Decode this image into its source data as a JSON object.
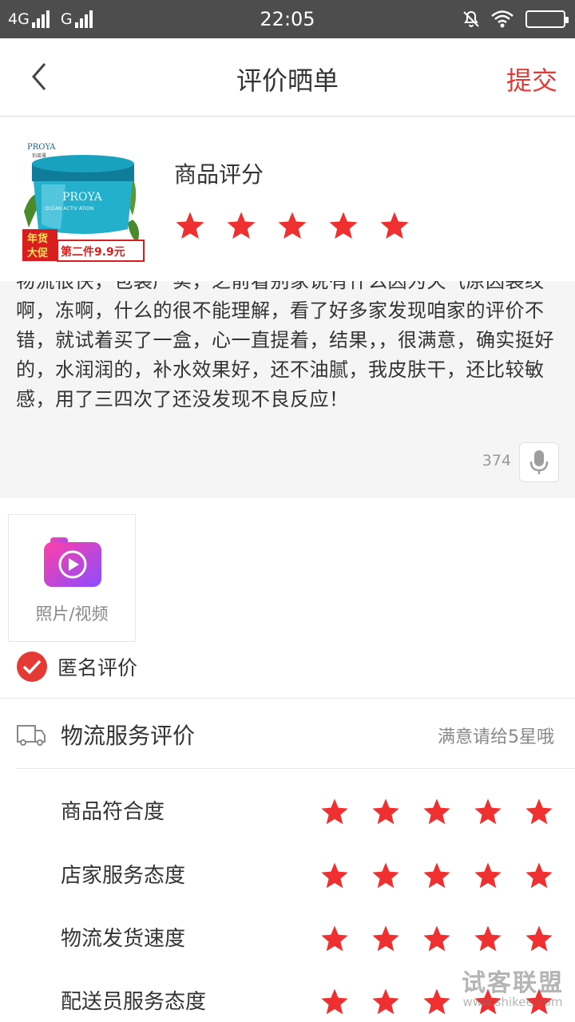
{
  "status_bar": {
    "network1": "4G",
    "network2": "G",
    "time": "22:05"
  },
  "nav": {
    "title": "评价晒单",
    "submit": "提交"
  },
  "product": {
    "rating_label": "商品评分",
    "rating_stars": 5,
    "image_brand": "PROYA",
    "image_brand_cn": "珀莱雅",
    "image_line": "OCEAN ACTIV ATION",
    "badge_left_1": "年货",
    "badge_left_2": "大促",
    "badge_right": "第二件9.9元"
  },
  "review": {
    "text": "物流很快，包装严实，之前看别家说有什么因为天气原因裂纹啊，冻啊，什么的很不能理解，看了好多家发现咱家的评价不错，就试着买了一盒，心一直提着，结果，，很满意，确实挺好的，水润润的，补水效果好，还不油腻，我皮肤干，还比较敏感，用了三四次了还没发现不良反应！",
    "char_count": "374"
  },
  "upload": {
    "label": "照片/视频"
  },
  "anonymous": {
    "label": "匿名评价",
    "checked": true
  },
  "logistics": {
    "title": "物流服务评价",
    "hint": "满意请给5星哦"
  },
  "ratings": [
    {
      "label": "商品符合度",
      "stars": 5
    },
    {
      "label": "店家服务态度",
      "stars": 5
    },
    {
      "label": "物流发货速度",
      "stars": 5
    },
    {
      "label": "配送员服务态度",
      "stars": 5
    }
  ],
  "watermark": {
    "main": "试客联盟",
    "sub": "www.shikee.com"
  },
  "colors": {
    "accent": "#e53935",
    "star": "#f03030",
    "status_bar": "#4d4d4d"
  }
}
